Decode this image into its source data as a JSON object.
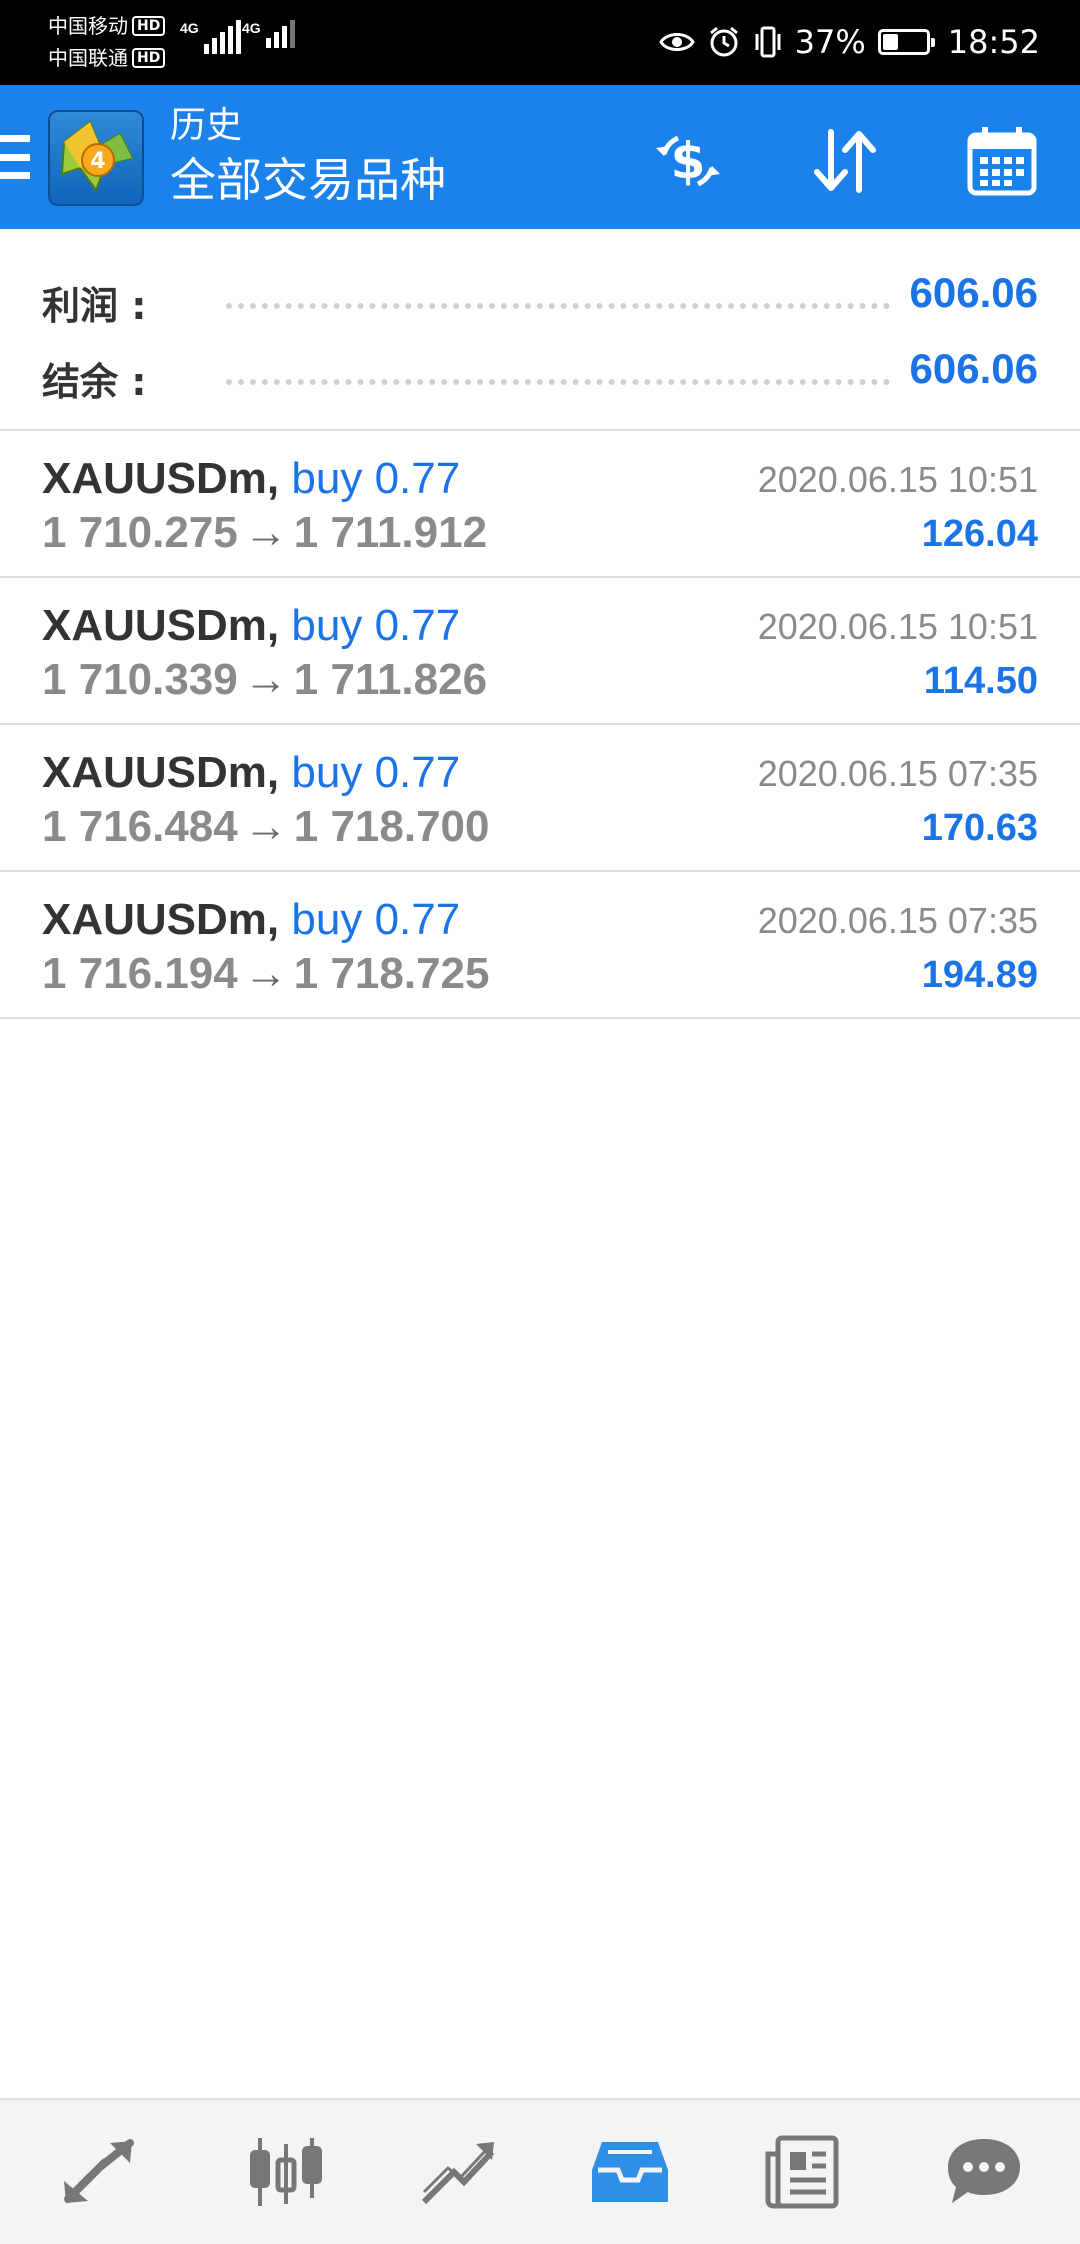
{
  "status_bar": {
    "carrier1": "中国移动",
    "carrier2": "中国联通",
    "hd_badge": "HD",
    "network1": "4G",
    "network2": "4G",
    "battery_percent_text": "37%",
    "battery_level": 0.37,
    "time": "18:52"
  },
  "app_bar": {
    "title": "历史",
    "subtitle": "全部交易品种"
  },
  "summary": {
    "profit_label": "利润 :",
    "profit_value": "606.06",
    "balance_label": "结余 :",
    "balance_value": "606.06"
  },
  "trades": [
    {
      "symbol": "XAUUSDm,",
      "side": "buy",
      "volume": "0.77",
      "open_price": "1 710.275",
      "close_price": "1 711.912",
      "time": "2020.06.15 10:51",
      "profit": "126.04"
    },
    {
      "symbol": "XAUUSDm,",
      "side": "buy",
      "volume": "0.77",
      "open_price": "1 710.339",
      "close_price": "1 711.826",
      "time": "2020.06.15 10:51",
      "profit": "114.50"
    },
    {
      "symbol": "XAUUSDm,",
      "side": "buy",
      "volume": "0.77",
      "open_price": "1 716.484",
      "close_price": "1 718.700",
      "time": "2020.06.15 07:35",
      "profit": "170.63"
    },
    {
      "symbol": "XAUUSDm,",
      "side": "buy",
      "volume": "0.77",
      "open_price": "1 716.194",
      "close_price": "1 718.725",
      "time": "2020.06.15 07:35",
      "profit": "194.89"
    }
  ],
  "icons": {
    "app_bar": [
      "menu-icon",
      "metatrader-logo-icon",
      "currency-exchange-icon",
      "sort-icon",
      "calendar-icon"
    ],
    "bottom_nav": [
      "trade-icon",
      "quotes-icon",
      "chart-icon",
      "history-icon",
      "news-icon",
      "chat-icon"
    ]
  },
  "colors": {
    "app_bar_bg": "#1b82ec",
    "accent_blue": "#1a73e8",
    "active_nav": "#2f8fe8",
    "inactive_nav": "#777777"
  }
}
